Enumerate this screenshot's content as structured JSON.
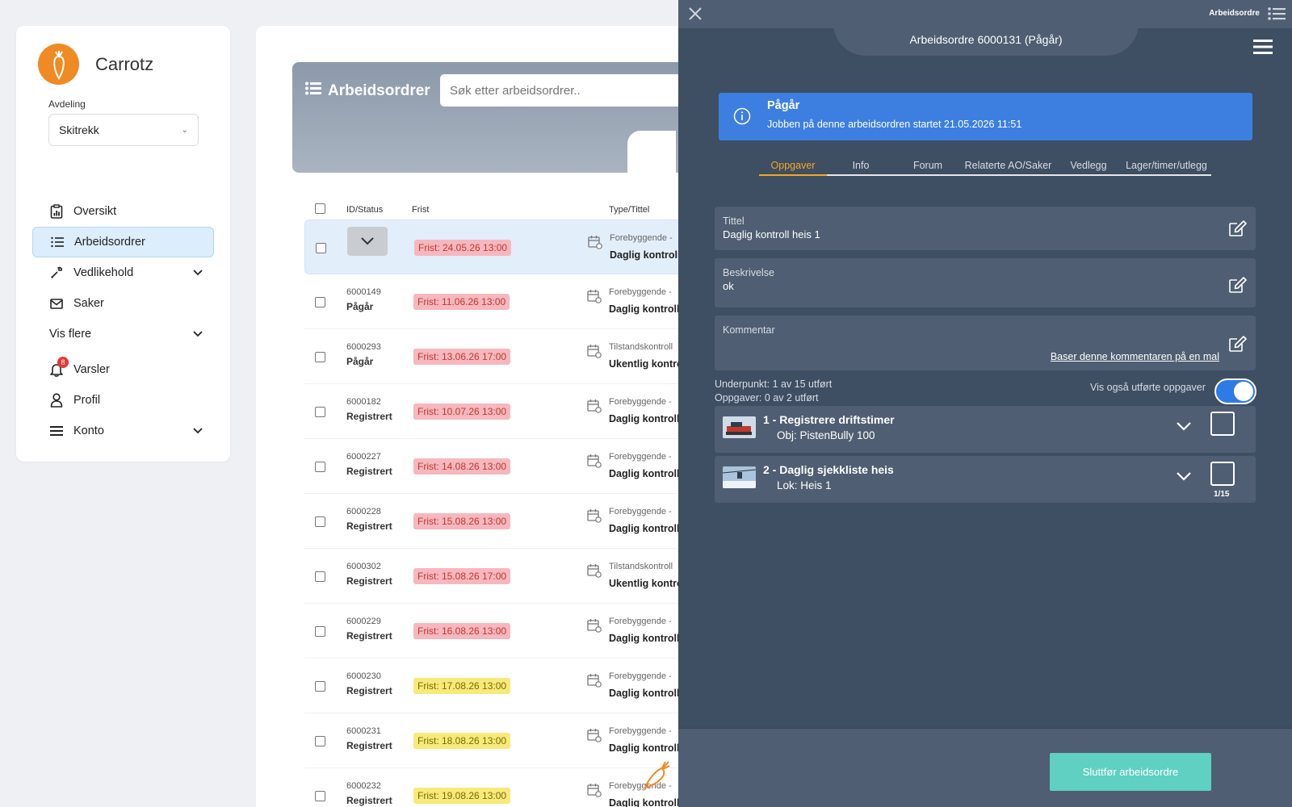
{
  "sidebar": {
    "brand": "Carrotz",
    "department_label": "Avdeling",
    "department_value": "Skitrekk",
    "items": [
      {
        "label": "Oversikt"
      },
      {
        "label": "Arbeidsordrer"
      },
      {
        "label": "Vedlikehold"
      },
      {
        "label": "Saker"
      },
      {
        "label": "Vis flere"
      }
    ],
    "bottom_items": [
      {
        "label": "Varsler",
        "badge": "8"
      },
      {
        "label": "Profil"
      },
      {
        "label": "Konto"
      }
    ]
  },
  "list": {
    "title": "Arbeidsordrer",
    "search_placeholder": "Søk etter arbeidsordrer..",
    "columns": {
      "id_status": "ID/Status",
      "due": "Frist",
      "type_title": "Type/Tittel"
    },
    "rows": [
      {
        "id": "",
        "status": "",
        "due": "Frist: 24.05.26 13:00",
        "due_color": "#f6b7be",
        "type": "Forebyggende -",
        "title": "Daglig kontroll"
      },
      {
        "id": "6000149",
        "status": "Pågår",
        "due": "Frist: 11.06.26 13:00",
        "due_color": "#f6b7be",
        "type": "Forebyggende -",
        "title": "Daglig kontroll"
      },
      {
        "id": "6000293",
        "status": "Pågår",
        "due": "Frist: 13.06.26 17:00",
        "due_color": "#f6b7be",
        "type": "Tilstandskontroll",
        "title": "Ukentlig kontroll"
      },
      {
        "id": "6000182",
        "status": "Registrert",
        "due": "Frist: 10.07.26 13:00",
        "due_color": "#f6b7be",
        "type": "Forebyggende -",
        "title": "Daglig kontroll"
      },
      {
        "id": "6000227",
        "status": "Registrert",
        "due": "Frist: 14.08.26 13:00",
        "due_color": "#f6b7be",
        "type": "Forebyggende -",
        "title": "Daglig kontroll"
      },
      {
        "id": "6000228",
        "status": "Registrert",
        "due": "Frist: 15.08.26 13:00",
        "due_color": "#f6b7be",
        "type": "Forebyggende -",
        "title": "Daglig kontroll"
      },
      {
        "id": "6000302",
        "status": "Registrert",
        "due": "Frist: 15.08.26 17:00",
        "due_color": "#f6b7be",
        "type": "Tilstandskontroll",
        "title": "Ukentlig kontroll"
      },
      {
        "id": "6000229",
        "status": "Registrert",
        "due": "Frist: 16.08.26 13:00",
        "due_color": "#f6b7be",
        "type": "Forebyggende -",
        "title": "Daglig kontroll"
      },
      {
        "id": "6000230",
        "status": "Registrert",
        "due": "Frist: 17.08.26 13:00",
        "due_color": "#f7ea7a",
        "type": "Forebyggende -",
        "title": "Daglig kontroll"
      },
      {
        "id": "6000231",
        "status": "Registrert",
        "due": "Frist: 18.08.26 13:00",
        "due_color": "#f7ea7a",
        "type": "Forebyggende -",
        "title": "Daglig kontroll"
      },
      {
        "id": "6000232",
        "status": "Registrert",
        "due": "Frist: 19.08.26 13:00",
        "due_color": "#f7ea7a",
        "type": "Forebyggende -",
        "title": "Daglig kontroll"
      }
    ]
  },
  "panel": {
    "topbar_title": "Arbeidsordre",
    "header": "Arbeidsordre 6000131 (Pågår)",
    "alert": {
      "title": "Pågår",
      "text": "Jobben på denne arbeidsordren startet 21.05.2026 11:51"
    },
    "tabs": [
      "Oppgaver",
      "Info",
      "Forum",
      "Relaterte AO/Saker",
      "Vedlegg",
      "Lager/timer/utlegg"
    ],
    "fields": {
      "title_label": "Tittel",
      "title_value": "Daglig kontroll heis 1",
      "description_label": "Beskrivelse",
      "description_value": "ok",
      "comment_label": "Kommentar",
      "comment_link": "Baser denne kommentaren på en mal"
    },
    "counters": {
      "subpoints": "Underpunkt: 1 av 15 utført",
      "tasks": "Oppgaver: 0 av 2 utført"
    },
    "toggle_label": "Vis også utførte oppgaver",
    "tasks": [
      {
        "title": "1 - Registrere driftstimer",
        "sub": "Obj: PistenBully 100",
        "count": ""
      },
      {
        "title": "2 - Daglig sjekkliste heis",
        "sub": "Lok: Heis 1",
        "count": "1/15"
      }
    ],
    "finish_button": "Sluttfør arbeidsordre"
  },
  "colors": {
    "panel_bg": "#3e4e63",
    "card_bg": "#4f5e72",
    "alert_blue": "#3d7fe0",
    "active_tab": "#f5a623",
    "finish_btn": "#5fd0c2",
    "brand_orange": "#f08a24"
  }
}
